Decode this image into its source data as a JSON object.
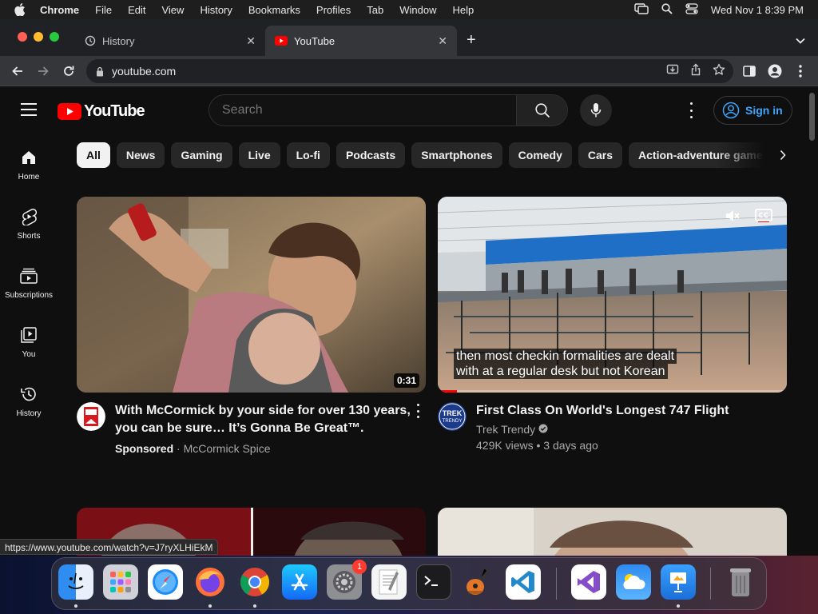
{
  "menubar": {
    "items": [
      "Chrome",
      "File",
      "Edit",
      "View",
      "History",
      "Bookmarks",
      "Profiles",
      "Tab",
      "Window",
      "Help"
    ],
    "datetime": "Wed Nov 1  8:39 PM"
  },
  "tabs": [
    {
      "title": "History",
      "icon": "history-icon"
    },
    {
      "title": "YouTube",
      "icon": "youtube-favicon"
    }
  ],
  "omnibox": {
    "url": "youtube.com"
  },
  "youtube": {
    "logo_text": "YouTube",
    "search_placeholder": "Search",
    "sign_in": "Sign in",
    "sidebar": [
      {
        "label": "Home",
        "icon": "home-icon"
      },
      {
        "label": "Shorts",
        "icon": "shorts-icon"
      },
      {
        "label": "Subscriptions",
        "icon": "subscriptions-icon"
      },
      {
        "label": "You",
        "icon": "you-icon"
      },
      {
        "label": "History",
        "icon": "history-icon"
      }
    ],
    "chips": [
      "All",
      "News",
      "Gaming",
      "Live",
      "Lo-fi",
      "Podcasts",
      "Smartphones",
      "Comedy",
      "Cars",
      "Action-adventure games"
    ],
    "videos": [
      {
        "title": "With McCormick by your side for over 130 years, you can be sure… It’s Gonna Be Great™.",
        "sponsored_label": "Sponsored",
        "channel": "McCormick Spice",
        "duration": "0:31"
      },
      {
        "title": "First Class On World's Longest 747 Flight",
        "channel": "Trek Trendy",
        "stats": "429K views • 3 days ago",
        "caption_line1": "then most checkin formalities are dealt",
        "caption_line2": "with at a regular desk but not Korean",
        "avatar_text": "TREK\nTRENDY",
        "progress": 0.055
      }
    ]
  },
  "status_url": "https://www.youtube.com/watch?v=J7ryXLHiEkM",
  "dock": {
    "apps": [
      "Finder",
      "Launchpad",
      "Safari",
      "Firefox",
      "Chrome",
      "App Store",
      "System Settings",
      "TextEdit",
      "Terminal",
      "GarageBand",
      "Visual Studio Code",
      "Visual Studio",
      "Weather",
      "Keynote",
      "Trash"
    ],
    "settings_badge": "1"
  }
}
